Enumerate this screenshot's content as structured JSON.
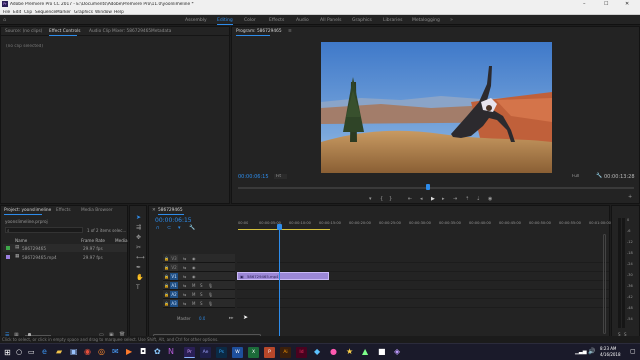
{
  "window": {
    "title": "Adobe Premiere Pro CC 2017 - E:\\Documents\\Adobe\\Premiere Pro\\11.0\\yoonlimeline *",
    "controls": {
      "minimize": "–",
      "maximize": "☐",
      "close": "✕"
    }
  },
  "menu": [
    "File",
    "Edit",
    "Clip",
    "Sequence",
    "Marker",
    "Graphics",
    "Window",
    "Help"
  ],
  "workspaces": {
    "items": [
      "Assembly",
      "Editing",
      "Color",
      "Effects",
      "Audio",
      "All Panels",
      "Graphics",
      "Libraries",
      "Metalogging"
    ],
    "active": "Editing"
  },
  "source_panel": {
    "tabs": [
      "Source: (no clips)",
      "Effect Controls",
      "Audio Clip Mixer: 586729465",
      "Metadata"
    ],
    "active_tab": "Effect Controls",
    "body_text": "(no clip selected)"
  },
  "program_monitor": {
    "title": "Program: 586729465",
    "timecode_left": "00:00:06:15",
    "zoom": "Fit",
    "quality": "Full",
    "timecode_right": "00:00:13:28",
    "playhead_fraction": 0.48
  },
  "project_panel": {
    "tabs": [
      "Project: yoonslimeline",
      "Effects",
      "Media Browser"
    ],
    "active_tab": "Project: yoonslimeline",
    "project_file": "yoonslimeline.prproj",
    "items_count": "1 of 2 items selec...",
    "columns": [
      "Name",
      "Frame Rate",
      "Media"
    ],
    "rows": [
      {
        "name": "586729465",
        "frame_rate": "29.97 fps",
        "color": "#3ea84a"
      },
      {
        "name": "586729465.mp4",
        "frame_rate": "29.97 fps",
        "color": "#9b7fe0"
      }
    ]
  },
  "timeline": {
    "sequence_tab": "586729465",
    "timecode": "00:00:06:15",
    "ruler_labels": [
      "00:00",
      "00:00:05:00",
      "00:00:10:00",
      "00:00:15:00",
      "00:00:20:00",
      "00:00:25:00",
      "00:00:30:00",
      "00:00:35:00",
      "00:00:40:00",
      "00:00:45:00",
      "00:00:50:00",
      "00:00:55:00",
      "00:01:00:00"
    ],
    "video_tracks": [
      "V3",
      "V2",
      "V1"
    ],
    "audio_tracks": [
      "A1",
      "A2",
      "A3"
    ],
    "master": "Master",
    "master_value": "0.0",
    "clip_label": "586729465.mp4",
    "track_mute": "M",
    "track_solo": "S"
  },
  "audio_meter": {
    "scale": [
      "0",
      "-6",
      "-12",
      "-18",
      "-24",
      "-30",
      "-36",
      "-42",
      "-48",
      "-54"
    ],
    "solo": "S",
    "solo2": "S"
  },
  "status_bar": {
    "text": "Click to select, or click in empty space and drag to marquee select. Use Shift, Alt, and Ctrl for other options."
  },
  "taskbar": {
    "apps": [
      "Pr",
      "Ae",
      "Ps",
      "W",
      "X",
      "P",
      "Ai",
      "Id"
    ],
    "time": "8:23 AM",
    "date": "4/16/2018"
  },
  "colors": {
    "accent": "#2d8ceb",
    "clip": "#9b87d6"
  }
}
